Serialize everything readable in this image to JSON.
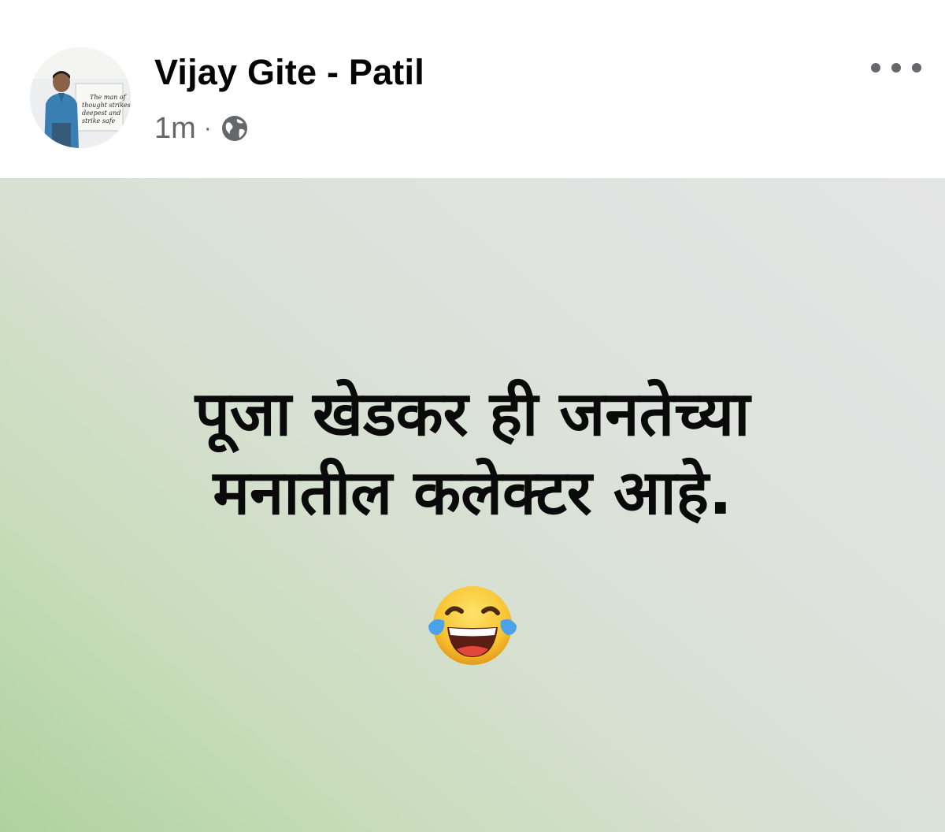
{
  "post": {
    "author": {
      "name": "Vijay Gite - Patil",
      "avatar_caption": [
        "The man of",
        "thought strikes",
        "deepest and",
        "strike safe"
      ]
    },
    "timestamp": "1m",
    "separator": "·",
    "audience_icon": "globe-icon",
    "more_icon": "more-options-icon",
    "content": {
      "lines": [
        "पूजा खेडकर ही जनतेच्या",
        "मनातील कलेक्टर आहे."
      ],
      "emoji": "face-with-tears-of-joy"
    }
  },
  "colors": {
    "name": "#050505",
    "meta": "#65676b",
    "background_green": "#aed29e",
    "background_grey": "#e4e5e5",
    "emoji_yellow": "#f7c331",
    "emoji_tears": "#4aa3e8"
  }
}
